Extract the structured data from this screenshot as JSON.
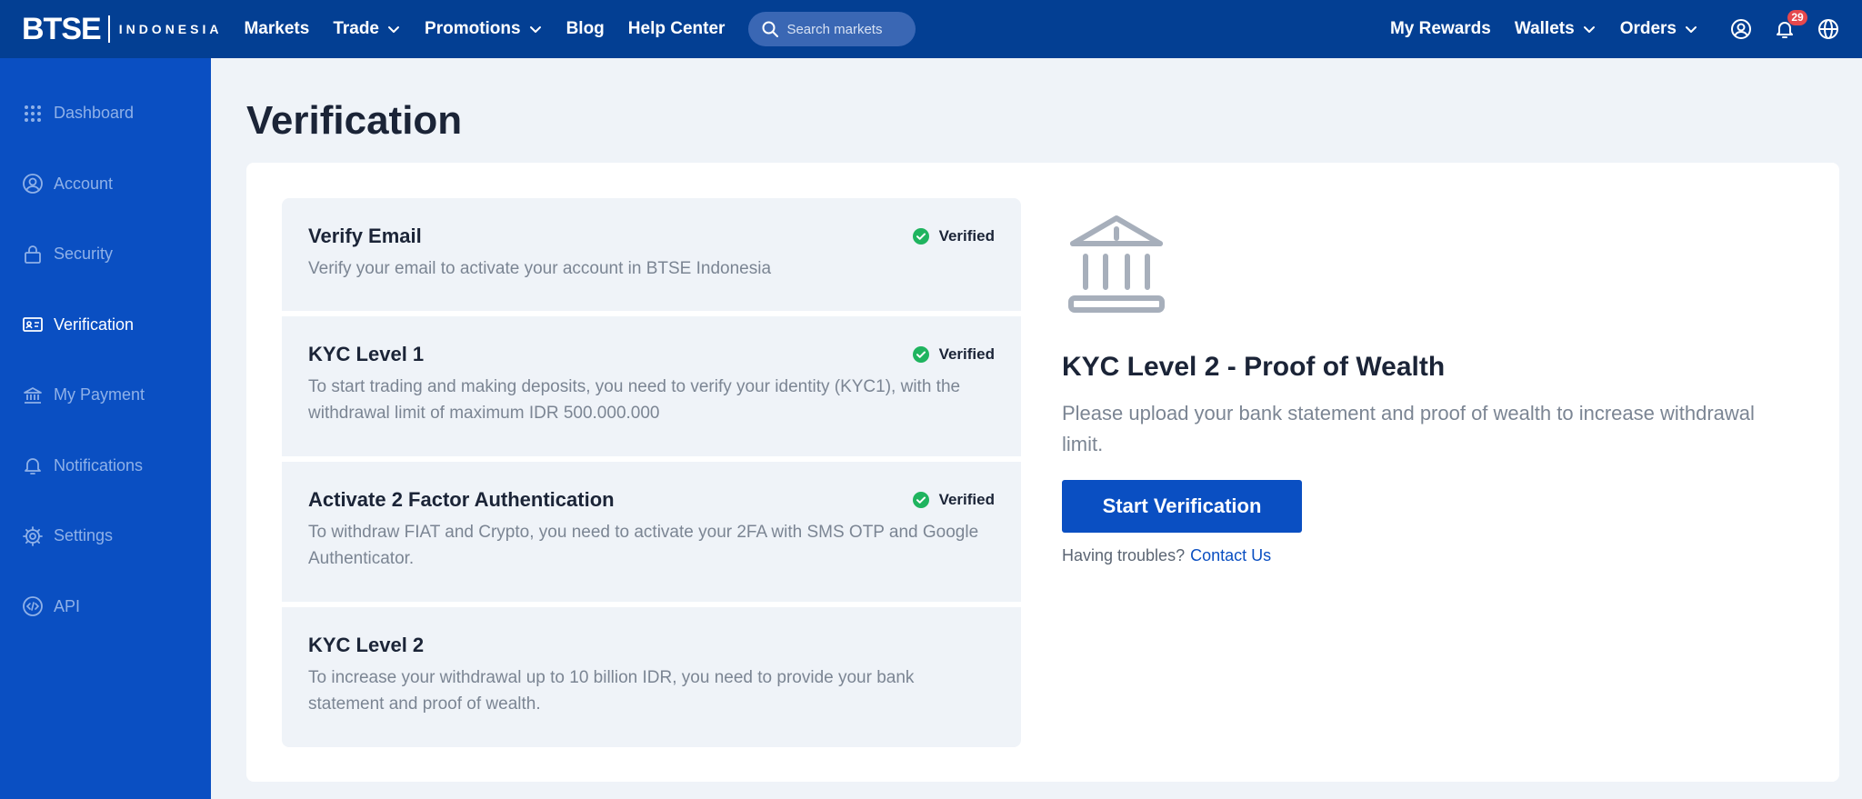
{
  "brand": {
    "name": "BTSE",
    "region": "INDONESIA"
  },
  "topnav": {
    "items": [
      {
        "label": "Markets",
        "dropdown": false
      },
      {
        "label": "Trade",
        "dropdown": true
      },
      {
        "label": "Promotions",
        "dropdown": true
      },
      {
        "label": "Blog",
        "dropdown": false
      },
      {
        "label": "Help Center",
        "dropdown": false
      }
    ],
    "search_placeholder": "Search markets",
    "right_items": [
      {
        "label": "My Rewards",
        "dropdown": false
      },
      {
        "label": "Wallets",
        "dropdown": true
      },
      {
        "label": "Orders",
        "dropdown": true
      }
    ],
    "notification_count": "29"
  },
  "sidebar": {
    "items": [
      {
        "label": "Dashboard",
        "icon": "grid-icon",
        "active": false
      },
      {
        "label": "Account",
        "icon": "user-icon",
        "active": false
      },
      {
        "label": "Security",
        "icon": "lock-icon",
        "active": false
      },
      {
        "label": "Verification",
        "icon": "id-card-icon",
        "active": true
      },
      {
        "label": "My Payment",
        "icon": "bank-icon",
        "active": false
      },
      {
        "label": "Notifications",
        "icon": "bell-icon",
        "active": false
      },
      {
        "label": "Settings",
        "icon": "gear-icon",
        "active": false
      },
      {
        "label": "API",
        "icon": "code-icon",
        "active": false
      }
    ]
  },
  "page": {
    "title": "Verification"
  },
  "steps": [
    {
      "title": "Verify Email",
      "description": "Verify your email to activate your account in BTSE Indonesia",
      "status": "Verified"
    },
    {
      "title": "KYC Level 1",
      "description": "To start trading and making deposits, you need to verify your identity (KYC1), with the withdrawal limit of maximum IDR 500.000.000",
      "status": "Verified"
    },
    {
      "title": "Activate 2 Factor Authentication",
      "description": "To withdraw FIAT and Crypto, you need to activate your 2FA with SMS OTP and Google Authenticator.",
      "status": "Verified"
    },
    {
      "title": "KYC Level 2",
      "description": "To increase your withdrawal up to 10 billion IDR, you need to provide your bank statement and proof of wealth.",
      "status": ""
    }
  ],
  "kyc2": {
    "title": "KYC Level 2 - Proof of Wealth",
    "description": "Please upload your bank statement and proof of wealth to increase withdrawal limit.",
    "button_label": "Start Verification",
    "help_text": "Having troubles?",
    "help_link": "Contact Us"
  },
  "colors": {
    "topbar": "#033f93",
    "sidebar": "#0a4fc2",
    "primary": "#0a4fc2",
    "verified": "#1fb45f",
    "badge": "#e5484d"
  }
}
